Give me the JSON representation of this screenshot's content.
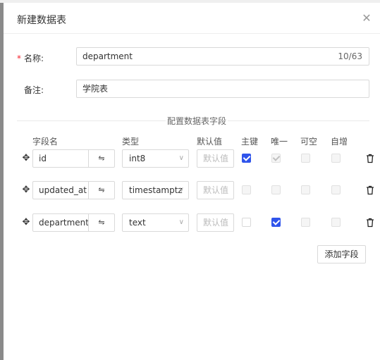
{
  "dialog": {
    "title": "新建数据表",
    "close_icon": "close-icon"
  },
  "form": {
    "name": {
      "required_mark": "*",
      "label": "名称:",
      "value": "department",
      "counter": "10/63"
    },
    "remark": {
      "label": "备注:",
      "value": "学院表"
    }
  },
  "fields_section": {
    "title": "配置数据表字段",
    "columns": [
      "字段名",
      "类型",
      "默认值",
      "主键",
      "唯一",
      "可空",
      "自增"
    ],
    "rows": [
      {
        "name": "id",
        "type": "int8",
        "default_placeholder": "默认值",
        "primary": true,
        "unique": true,
        "nullable": false,
        "auto_increment": false
      },
      {
        "name": "updated_at",
        "type": "timestamptz",
        "default_placeholder": "默认值",
        "primary": false,
        "unique": false,
        "nullable": false,
        "auto_increment": false
      },
      {
        "name": "departmentI",
        "type": "text",
        "default_placeholder": "默认值",
        "primary": false,
        "unique": true,
        "nullable": false,
        "auto_increment": false
      }
    ],
    "add_button": "添加字段"
  },
  "colors": {
    "accent": "#2f54eb",
    "required": "#f5222d",
    "border": "#d9d9d9"
  }
}
